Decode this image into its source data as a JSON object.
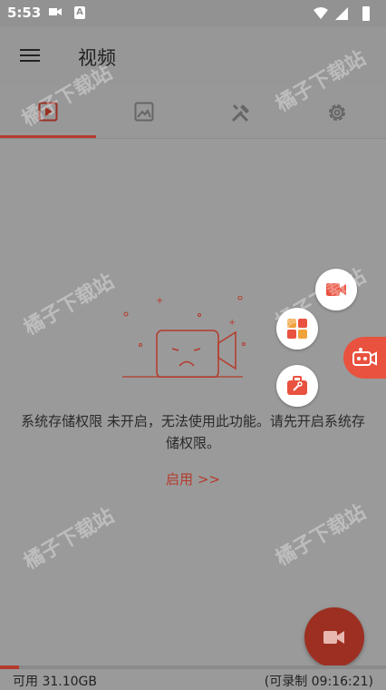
{
  "status_bar": {
    "time": "5:53",
    "a_icon_letter": "A"
  },
  "app_bar": {
    "title": "视频",
    "menu_icon": "menu-icon"
  },
  "tabs": [
    {
      "name": "videos",
      "icon": "video-icon",
      "active": true
    },
    {
      "name": "images",
      "icon": "image-icon",
      "active": false
    },
    {
      "name": "tools",
      "icon": "tools-icon",
      "active": false
    },
    {
      "name": "settings",
      "icon": "settings-icon",
      "active": false
    }
  ],
  "content": {
    "message": "系统存储权限 未开启，无法使用此功能。请先开启系统存储权限。",
    "enable_link": "启用 >>"
  },
  "floating_buttons": [
    {
      "name": "record-screen-button",
      "icon": "camera-icon"
    },
    {
      "name": "apps-button",
      "icon": "grid-icon"
    },
    {
      "name": "toolbox-button",
      "icon": "toolbox-icon"
    },
    {
      "name": "floating-recorder-button",
      "icon": "recorder-icon"
    }
  ],
  "fab": {
    "icon": "video-camera-icon"
  },
  "storage": {
    "free_label": "可用 31.10GB",
    "record_label": "(可录制 09:16:21)",
    "used_fraction": 0.05
  },
  "colors": {
    "accent": "#b53a2b",
    "float_red": "#e8523f"
  },
  "watermark": "橘子下载站"
}
